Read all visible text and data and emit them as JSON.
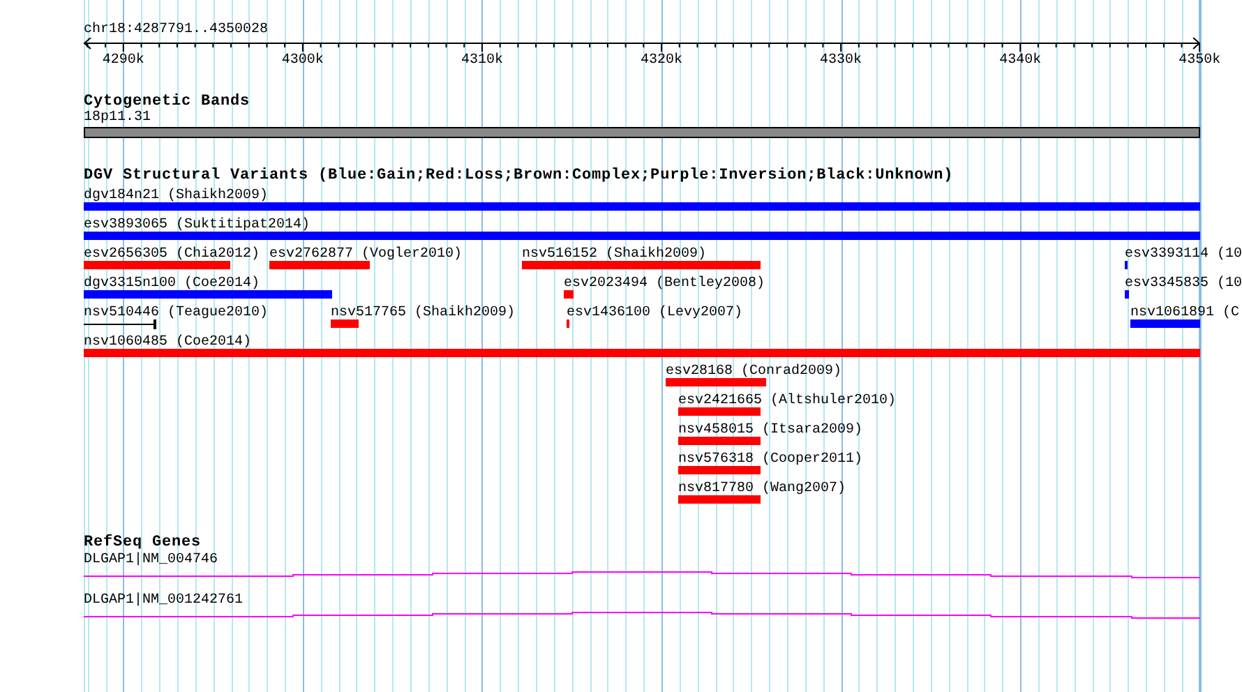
{
  "ruler": {
    "position": "chr18:4287791..4350028",
    "ticks": [
      "4290k",
      "4300k",
      "4310k",
      "4320k",
      "4330k",
      "4340k",
      "4350k"
    ]
  },
  "cytoband": {
    "title": "Cytogenetic Bands",
    "band": "18p11.31"
  },
  "variants": {
    "title": "DGV Structural Variants (Blue:Gain;Red:Loss;Brown:Complex;Purple:Inversion;Black:Unknown)",
    "features": [
      {
        "label": "dgv184n21 (Shaikh2009)",
        "kind": "gain"
      },
      {
        "label": "esv3893065 (Suktitipat2014)",
        "kind": "gain"
      },
      {
        "label": "esv2656305 (Chia2012)",
        "kind": "loss"
      },
      {
        "label": "esv2762877 (Vogler2010)",
        "kind": "loss"
      },
      {
        "label": "nsv516152 (Shaikh2009)",
        "kind": "loss"
      },
      {
        "label": "esv3393114 (10",
        "kind": "gain"
      },
      {
        "label": "dgv3315n100 (Coe2014)",
        "kind": "gain"
      },
      {
        "label": "esv2023494 (Bentley2008)",
        "kind": "loss"
      },
      {
        "label": "esv3345835 (10",
        "kind": "gain"
      },
      {
        "label": "nsv510446 (Teague2010)",
        "kind": "unknown"
      },
      {
        "label": "nsv517765 (Shaikh2009)",
        "kind": "loss"
      },
      {
        "label": "esv1436100 (Levy2007)",
        "kind": "loss"
      },
      {
        "label": "nsv1061891 (C",
        "kind": "gain"
      },
      {
        "label": "nsv1060485 (Coe2014)",
        "kind": "loss"
      },
      {
        "label": "esv28168 (Conrad2009)",
        "kind": "loss"
      },
      {
        "label": "esv2421665 (Altshuler2010)",
        "kind": "loss"
      },
      {
        "label": "nsv458015 (Itsara2009)",
        "kind": "loss"
      },
      {
        "label": "nsv576318 (Cooper2011)",
        "kind": "loss"
      },
      {
        "label": "nsv817780 (Wang2007)",
        "kind": "loss"
      }
    ]
  },
  "genes": {
    "title": "RefSeq Genes",
    "transcripts": [
      {
        "label": "DLGAP1|NM_004746"
      },
      {
        "label": "DLGAP1|NM_001242761"
      }
    ]
  }
}
